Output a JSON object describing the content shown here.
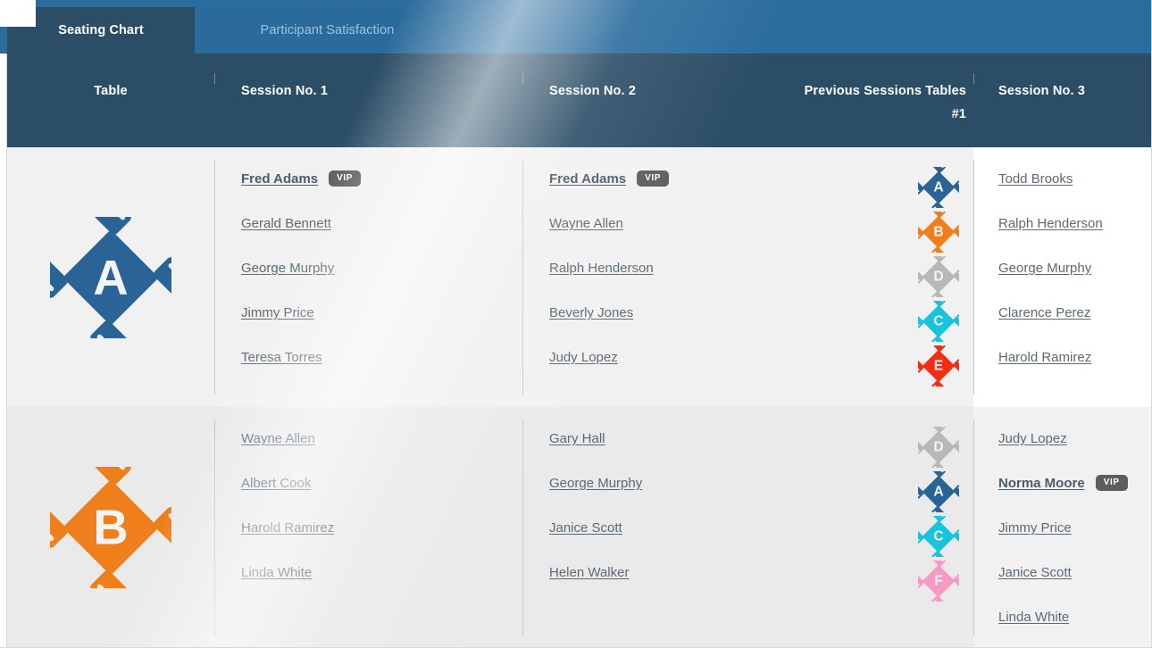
{
  "tabs": [
    {
      "label": "Seating Chart",
      "active": true
    },
    {
      "label": "Participant Satisfaction",
      "active": false
    }
  ],
  "columns": {
    "table": "Table",
    "session1": "Session No. 1",
    "session2": "Session No. 2",
    "previous": "Previous Sessions Tables",
    "previous_sub": "#1",
    "session3": "Session No. 3"
  },
  "badges": {
    "vip": "VIP"
  },
  "table_colors": {
    "A": "#2a6496",
    "B": "#ef7f1a",
    "C": "#18c3dd",
    "D": "#b8b8b8",
    "E": "#f42c13",
    "F": "#f79ac3"
  },
  "rows": [
    {
      "table": {
        "letter": "A",
        "color": "#2a6496"
      },
      "session1": [
        {
          "name": "Fred Adams",
          "vip": true
        },
        {
          "name": "Gerald Bennett",
          "vip": false
        },
        {
          "name": "George Murphy",
          "vip": false
        },
        {
          "name": "Jimmy Price",
          "vip": false
        },
        {
          "name": "Teresa Torres",
          "vip": false
        }
      ],
      "session2": [
        {
          "name": "Fred Adams",
          "vip": true
        },
        {
          "name": "Wayne Allen",
          "vip": false
        },
        {
          "name": "Ralph Henderson",
          "vip": false
        },
        {
          "name": "Beverly Jones",
          "vip": false
        },
        {
          "name": "Judy Lopez",
          "vip": false
        }
      ],
      "previous_tables": [
        {
          "letter": "A",
          "color": "#2a6496"
        },
        {
          "letter": "B",
          "color": "#ef7f1a"
        },
        {
          "letter": "D",
          "color": "#b8b8b8"
        },
        {
          "letter": "C",
          "color": "#18c3dd"
        },
        {
          "letter": "E",
          "color": "#f42c13"
        }
      ],
      "session3": [
        {
          "name": "Todd Brooks",
          "vip": false
        },
        {
          "name": "Ralph Henderson",
          "vip": false
        },
        {
          "name": "George Murphy",
          "vip": false
        },
        {
          "name": "Clarence Perez",
          "vip": false
        },
        {
          "name": "Harold Ramirez",
          "vip": false
        }
      ]
    },
    {
      "table": {
        "letter": "B",
        "color": "#ef7f1a"
      },
      "session1": [
        {
          "name": "Wayne Allen",
          "vip": false
        },
        {
          "name": "Albert Cook",
          "vip": false
        },
        {
          "name": "Harold Ramirez",
          "vip": false
        },
        {
          "name": "Linda White",
          "vip": false
        }
      ],
      "session2": [
        {
          "name": "Gary Hall",
          "vip": false
        },
        {
          "name": "George Murphy",
          "vip": false
        },
        {
          "name": "Janice Scott",
          "vip": false
        },
        {
          "name": "Helen Walker",
          "vip": false
        }
      ],
      "previous_tables": [
        {
          "letter": "D",
          "color": "#b8b8b8"
        },
        {
          "letter": "A",
          "color": "#2a6496"
        },
        {
          "letter": "C",
          "color": "#18c3dd"
        },
        {
          "letter": "F",
          "color": "#f79ac3"
        }
      ],
      "session3": [
        {
          "name": "Judy Lopez",
          "vip": false
        },
        {
          "name": "Norma Moore",
          "vip": true
        },
        {
          "name": "Jimmy Price",
          "vip": false
        },
        {
          "name": "Janice Scott",
          "vip": false
        },
        {
          "name": "Linda White",
          "vip": false
        }
      ]
    }
  ]
}
